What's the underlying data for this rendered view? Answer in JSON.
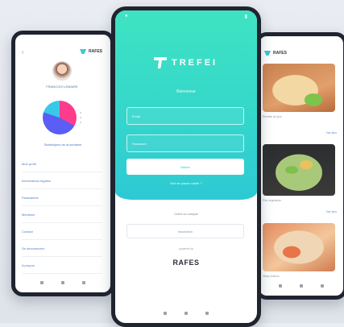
{
  "left_phone": {
    "header": {
      "back_icon": "chevron-left-icon",
      "brand": "RAFES"
    },
    "user_name": "FRANCOIS LEMAIRE",
    "pie_colors": [
      "#ff3c8b",
      "#5a5ef5",
      "#38c9e8"
    ],
    "pie_values": [
      0.33,
      0.47,
      0.2
    ],
    "pie_caption": "Statistiques de la semaine",
    "menu": [
      "Mon profil",
      "Informations legales",
      "Parametres",
      "Mentions",
      "Contact",
      "Se deconnecter",
      "A propos"
    ]
  },
  "center_phone": {
    "brand": "TREFEI",
    "login_title": "Bienvenue",
    "email_placeholder": "Email",
    "password_placeholder": "Password",
    "login_button": "Valider",
    "forgot": "Mot de passe oublie ?",
    "or_label": "Creer un compte",
    "outline_button": "Inscription",
    "powered_by": "powered by",
    "bottom_logo": "RAFES"
  },
  "right_phone": {
    "header": {
      "brand": "RAFES"
    },
    "captions": [
      "Recette du jour",
      "Plat vegetarien",
      "Wrap maison"
    ],
    "more_label": "Voir plus"
  }
}
